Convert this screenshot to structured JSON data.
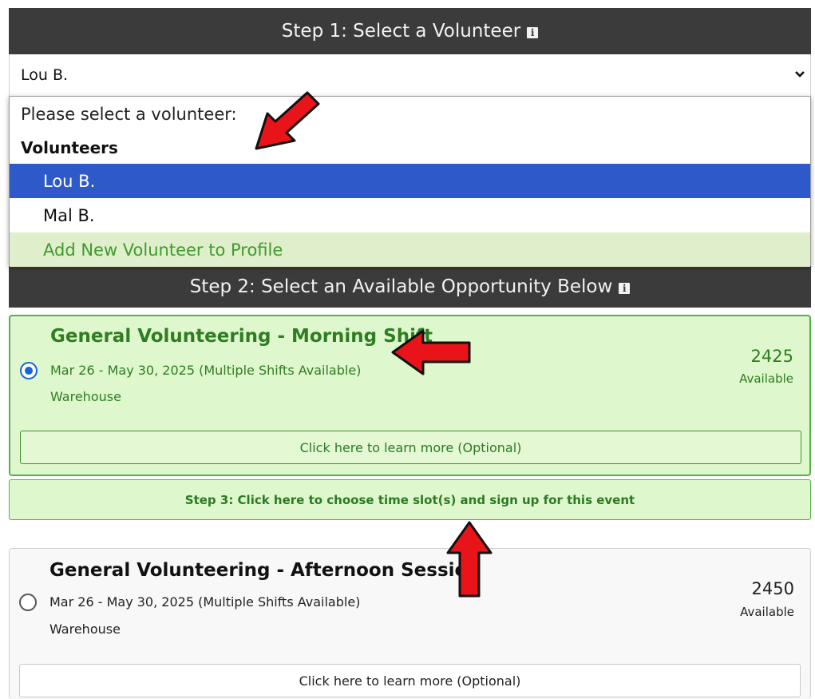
{
  "step1": {
    "header": "Step 1: Select a Volunteer",
    "info_icon": "info-icon",
    "selected_value": "Lou B."
  },
  "dropdown": {
    "placeholder": "Please select a volunteer:",
    "group_label": "Volunteers",
    "options": [
      "Lou B.",
      "Mal B."
    ],
    "selected_index": 0,
    "add_option": "Add New Volunteer to Profile"
  },
  "step2": {
    "header": "Step 2: Select an Available Opportunity Below",
    "info_icon": "info-icon"
  },
  "opportunities": [
    {
      "title": "General Volunteering - Morning Shift",
      "dates": "Mar 26 - May 30, 2025 (Multiple Shifts Available)",
      "location": "Warehouse",
      "count": "2425",
      "count_label": "Available",
      "learn_more": "Click here to learn more (Optional)",
      "selected": true
    },
    {
      "title": "General Volunteering - Afternoon Session",
      "dates": "Mar 26 - May 30, 2025 (Multiple Shifts Available)",
      "location": "Warehouse",
      "count": "2450",
      "count_label": "Available",
      "learn_more": "Click here to learn more (Optional)",
      "selected": false
    }
  ],
  "step3": {
    "label": "Step 3: Click here to choose time slot(s) and sign up for this event"
  },
  "colors": {
    "header_bg": "#3b3b3b",
    "selected_option": "#2d5ac8",
    "add_option_bg": "#dfeecb",
    "add_option_text": "#3f9a2e",
    "active_card_bg": "#dff7cc",
    "active_border": "#56b04a",
    "annotation_arrow": "#e8141a"
  }
}
